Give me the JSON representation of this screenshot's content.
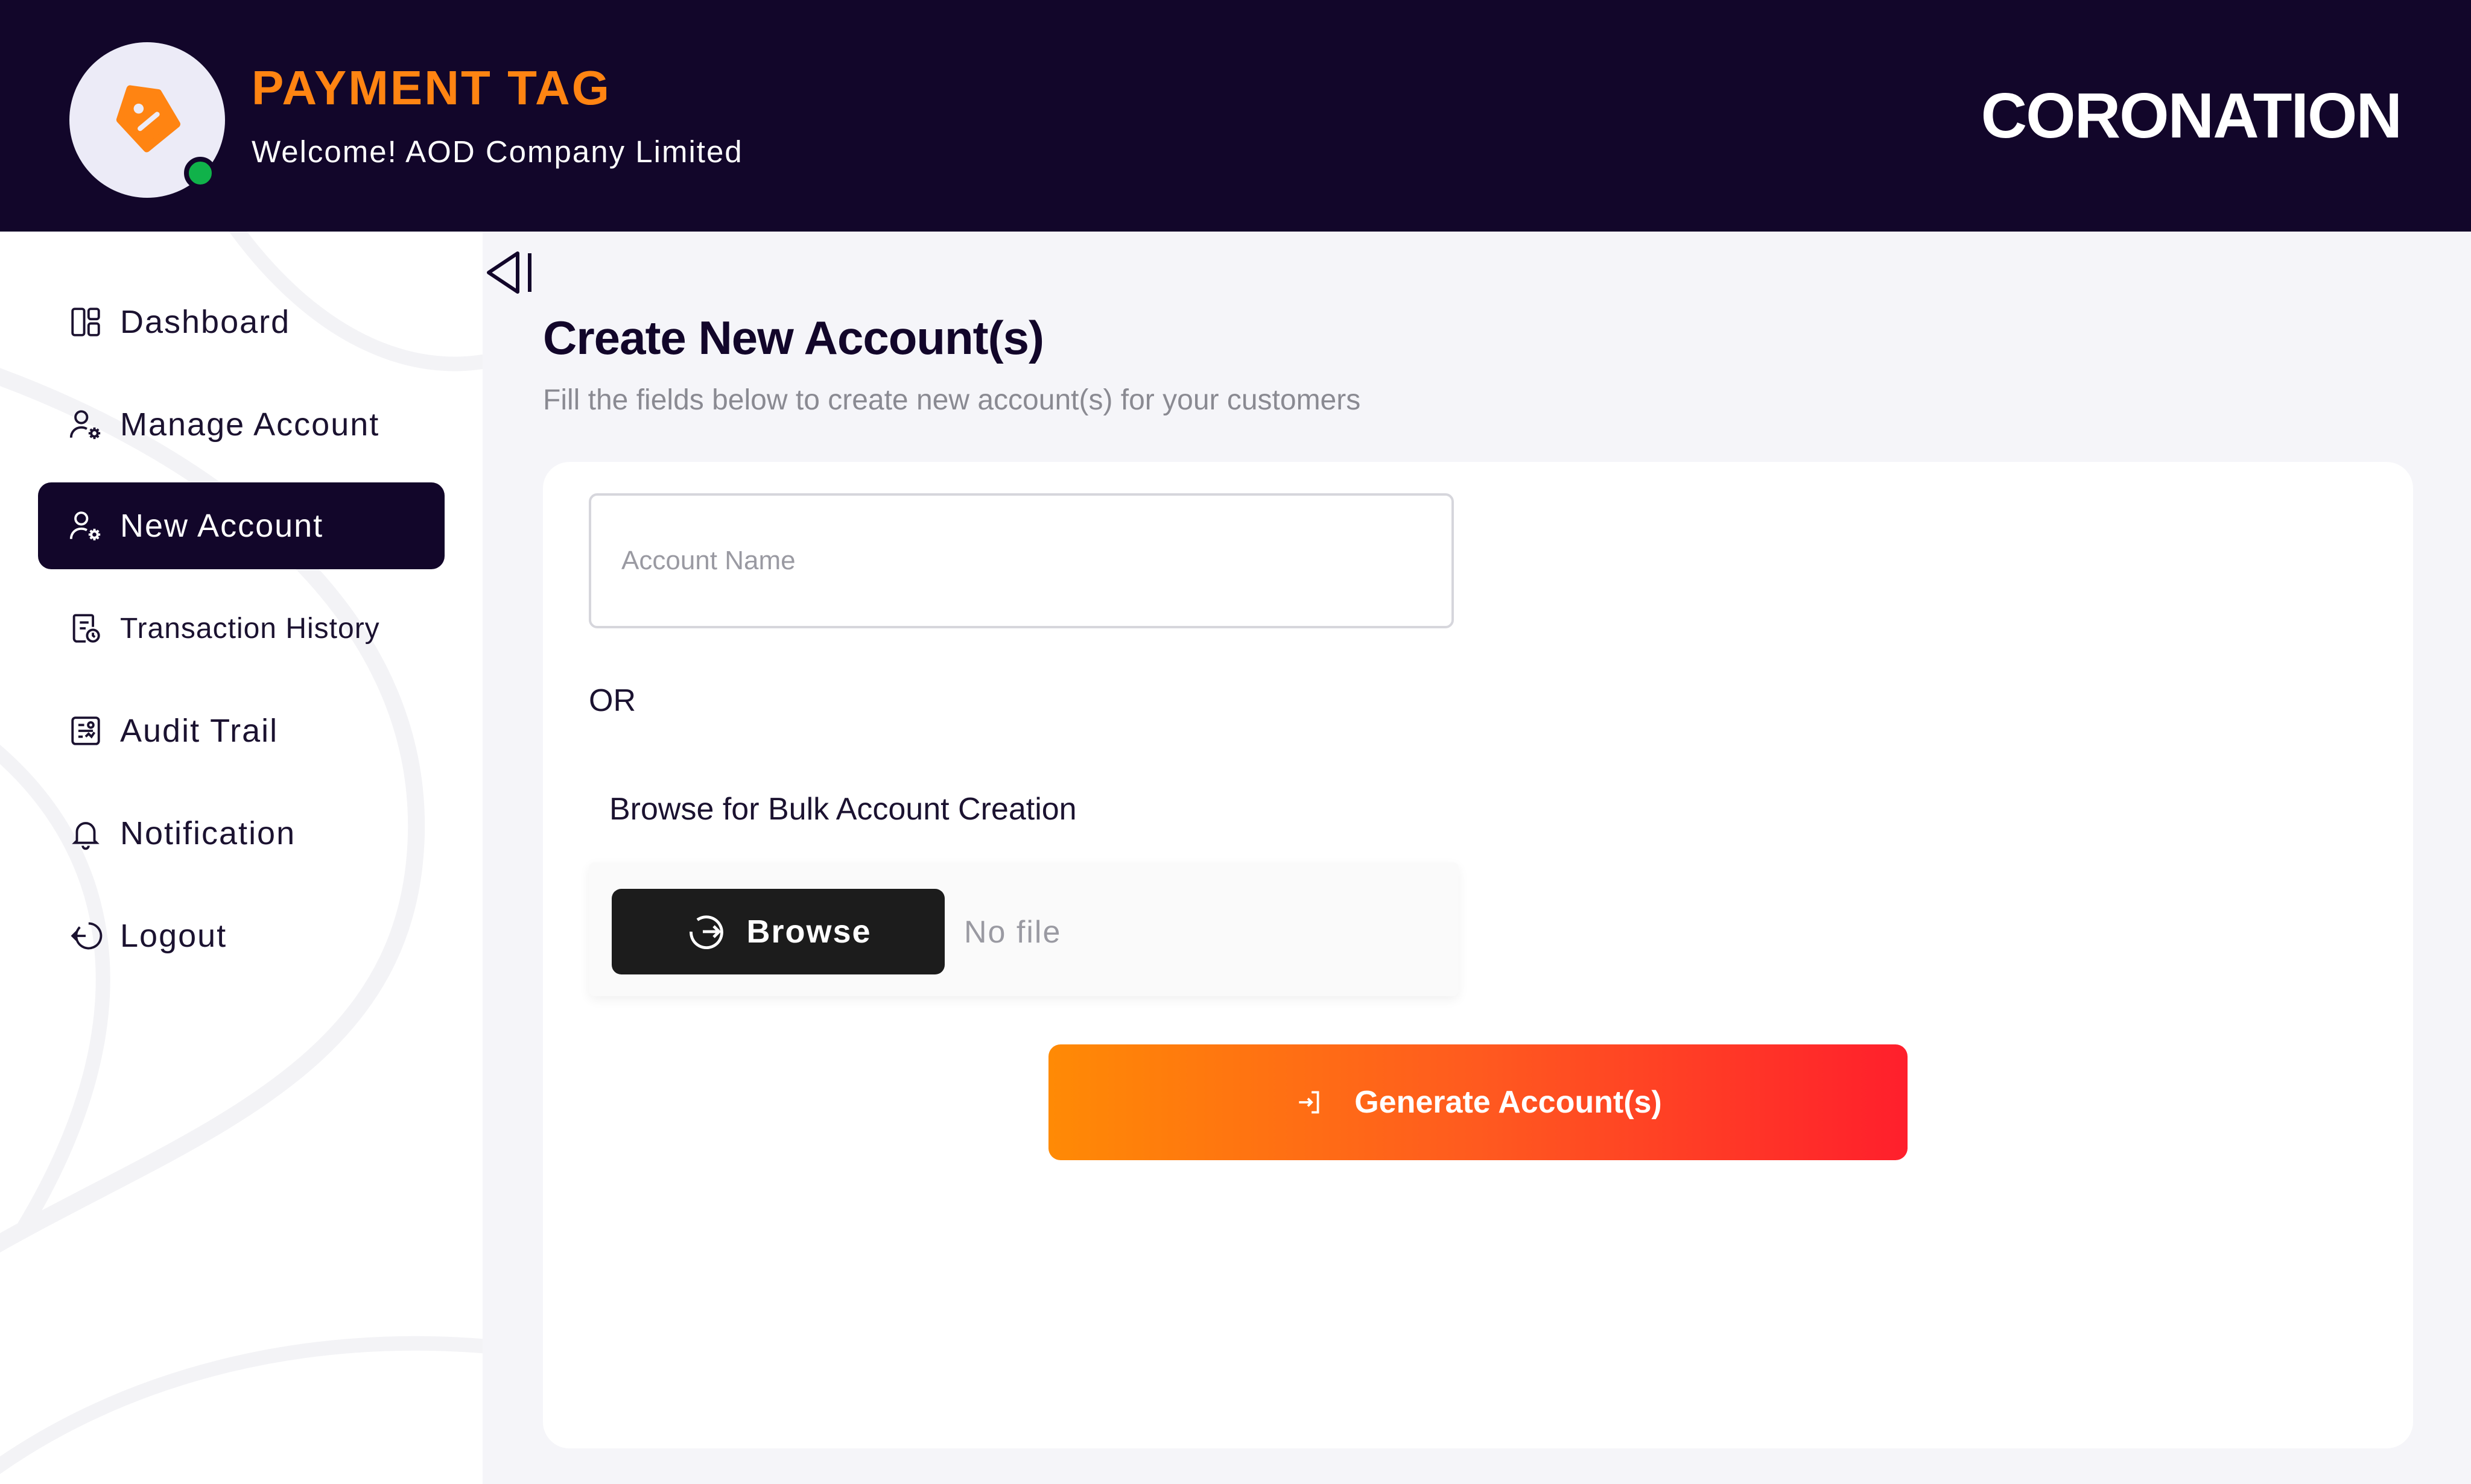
{
  "header": {
    "app_title": "PAYMENT TAG",
    "welcome": "Welcome! AOD Company Limited",
    "brand": "CORONATION",
    "status": "online"
  },
  "sidebar": {
    "items": [
      {
        "label": "Dashboard",
        "icon": "dashboard-icon"
      },
      {
        "label": "Manage Account",
        "icon": "user-gear-icon"
      },
      {
        "label": "New Account",
        "icon": "user-gear-icon",
        "active": true
      },
      {
        "label": "Transaction History",
        "icon": "receipt-clock-icon"
      },
      {
        "label": "Audit Trail",
        "icon": "audit-icon"
      },
      {
        "label": "Notification",
        "icon": "bell-icon"
      },
      {
        "label": "Logout",
        "icon": "logout-icon"
      }
    ]
  },
  "main": {
    "title": "Create New Account(s)",
    "subtitle": "Fill the fields below to create new account(s) for your customers",
    "account_name": {
      "placeholder": "Account Name",
      "value": ""
    },
    "or_label": "OR",
    "bulk_label": "Browse for Bulk Account Creation",
    "browse_label": "Browse",
    "file_status": "No file",
    "generate_label": "Generate Account(s)"
  },
  "colors": {
    "header_bg": "#12062a",
    "accent_orange": "#ff8412",
    "online": "#10b24a",
    "gradient_start": "#ff8a05",
    "gradient_end": "#ff1f2c"
  }
}
